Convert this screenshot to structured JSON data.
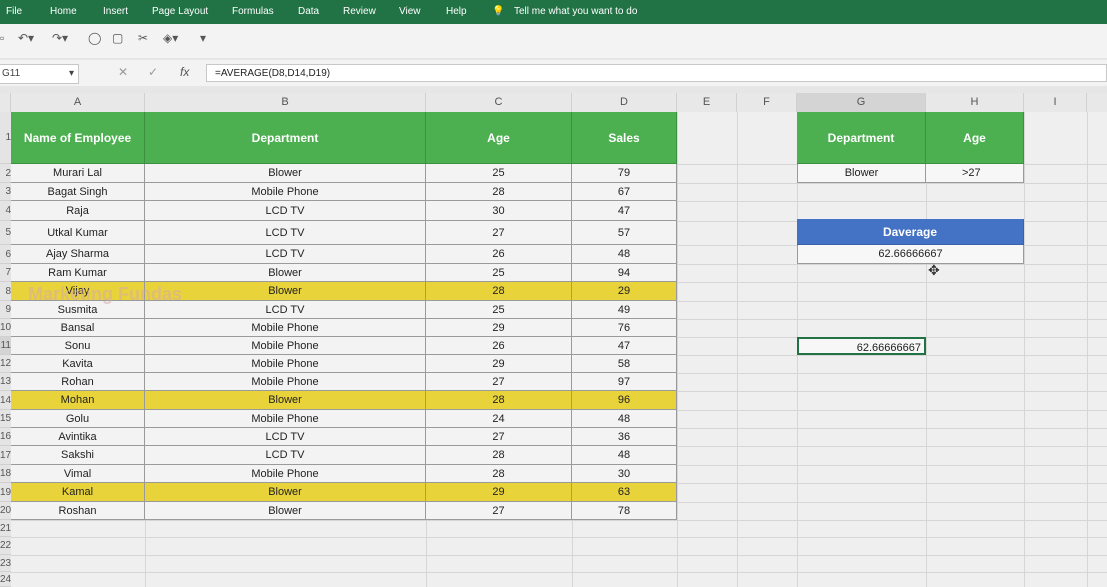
{
  "menu": [
    "File",
    "Home",
    "Insert",
    "Page Layout",
    "Formulas",
    "Data",
    "Review",
    "View",
    "Help"
  ],
  "tell_me": "Tell me what you want to do",
  "name_box": "G11",
  "formula": "=AVERAGE(D8,D14,D19)",
  "columns": [
    "A",
    "B",
    "C",
    "D",
    "E",
    "F",
    "G",
    "H",
    "I"
  ],
  "row_numbers": [
    "1",
    "2",
    "3",
    "4",
    "5",
    "6",
    "7",
    "8",
    "9",
    "10",
    "11",
    "12",
    "13",
    "14",
    "15",
    "16",
    "17",
    "18",
    "19",
    "20",
    "21",
    "22",
    "23",
    "24"
  ],
  "table": {
    "headers": [
      "Name of Employee",
      "Department",
      "Age",
      "Sales"
    ],
    "rows": [
      {
        "name": "Murari Lal",
        "dept": "Blower",
        "age": "25",
        "sales": "79",
        "hl": false
      },
      {
        "name": "Bagat Singh",
        "dept": "Mobile Phone",
        "age": "28",
        "sales": "67",
        "hl": false
      },
      {
        "name": "Raja",
        "dept": "LCD TV",
        "age": "30",
        "sales": "47",
        "hl": false
      },
      {
        "name": "Utkal Kumar",
        "dept": "LCD TV",
        "age": "27",
        "sales": "57",
        "hl": false
      },
      {
        "name": "Ajay Sharma",
        "dept": "LCD TV",
        "age": "26",
        "sales": "48",
        "hl": false
      },
      {
        "name": "Ram Kumar",
        "dept": "Blower",
        "age": "25",
        "sales": "94",
        "hl": false
      },
      {
        "name": "Vijay",
        "dept": "Blower",
        "age": "28",
        "sales": "29",
        "hl": true
      },
      {
        "name": "Susmita",
        "dept": "LCD TV",
        "age": "25",
        "sales": "49",
        "hl": false
      },
      {
        "name": "Bansal",
        "dept": "Mobile Phone",
        "age": "29",
        "sales": "76",
        "hl": false
      },
      {
        "name": "Sonu",
        "dept": "Mobile Phone",
        "age": "26",
        "sales": "47",
        "hl": false
      },
      {
        "name": "Kavita",
        "dept": "Mobile Phone",
        "age": "29",
        "sales": "58",
        "hl": false
      },
      {
        "name": "Rohan",
        "dept": "Mobile Phone",
        "age": "27",
        "sales": "97",
        "hl": false
      },
      {
        "name": "Mohan",
        "dept": "Blower",
        "age": "28",
        "sales": "96",
        "hl": true
      },
      {
        "name": "Golu",
        "dept": "Mobile Phone",
        "age": "24",
        "sales": "48",
        "hl": false
      },
      {
        "name": "Avintika",
        "dept": "LCD TV",
        "age": "27",
        "sales": "36",
        "hl": false
      },
      {
        "name": "Sakshi",
        "dept": "LCD TV",
        "age": "28",
        "sales": "48",
        "hl": false
      },
      {
        "name": "Vimal",
        "dept": "Mobile Phone",
        "age": "28",
        "sales": "30",
        "hl": false
      },
      {
        "name": "Kamal",
        "dept": "Blower",
        "age": "29",
        "sales": "63",
        "hl": true
      },
      {
        "name": "Roshan",
        "dept": "Blower",
        "age": "27",
        "sales": "78",
        "hl": false
      }
    ]
  },
  "criteria": {
    "headers": [
      "Department",
      "Age"
    ],
    "values": [
      "Blower",
      ">27"
    ]
  },
  "daverage": {
    "label": "Daverage",
    "value": "62.66666667"
  },
  "active_cell_value": "62.66666667",
  "watermark": "Marketing Fundas",
  "colors": {
    "ribbon": "#217346",
    "header_green": "#4caf50",
    "highlight": "#e8d43a",
    "daverage_blue": "#4472c4"
  }
}
